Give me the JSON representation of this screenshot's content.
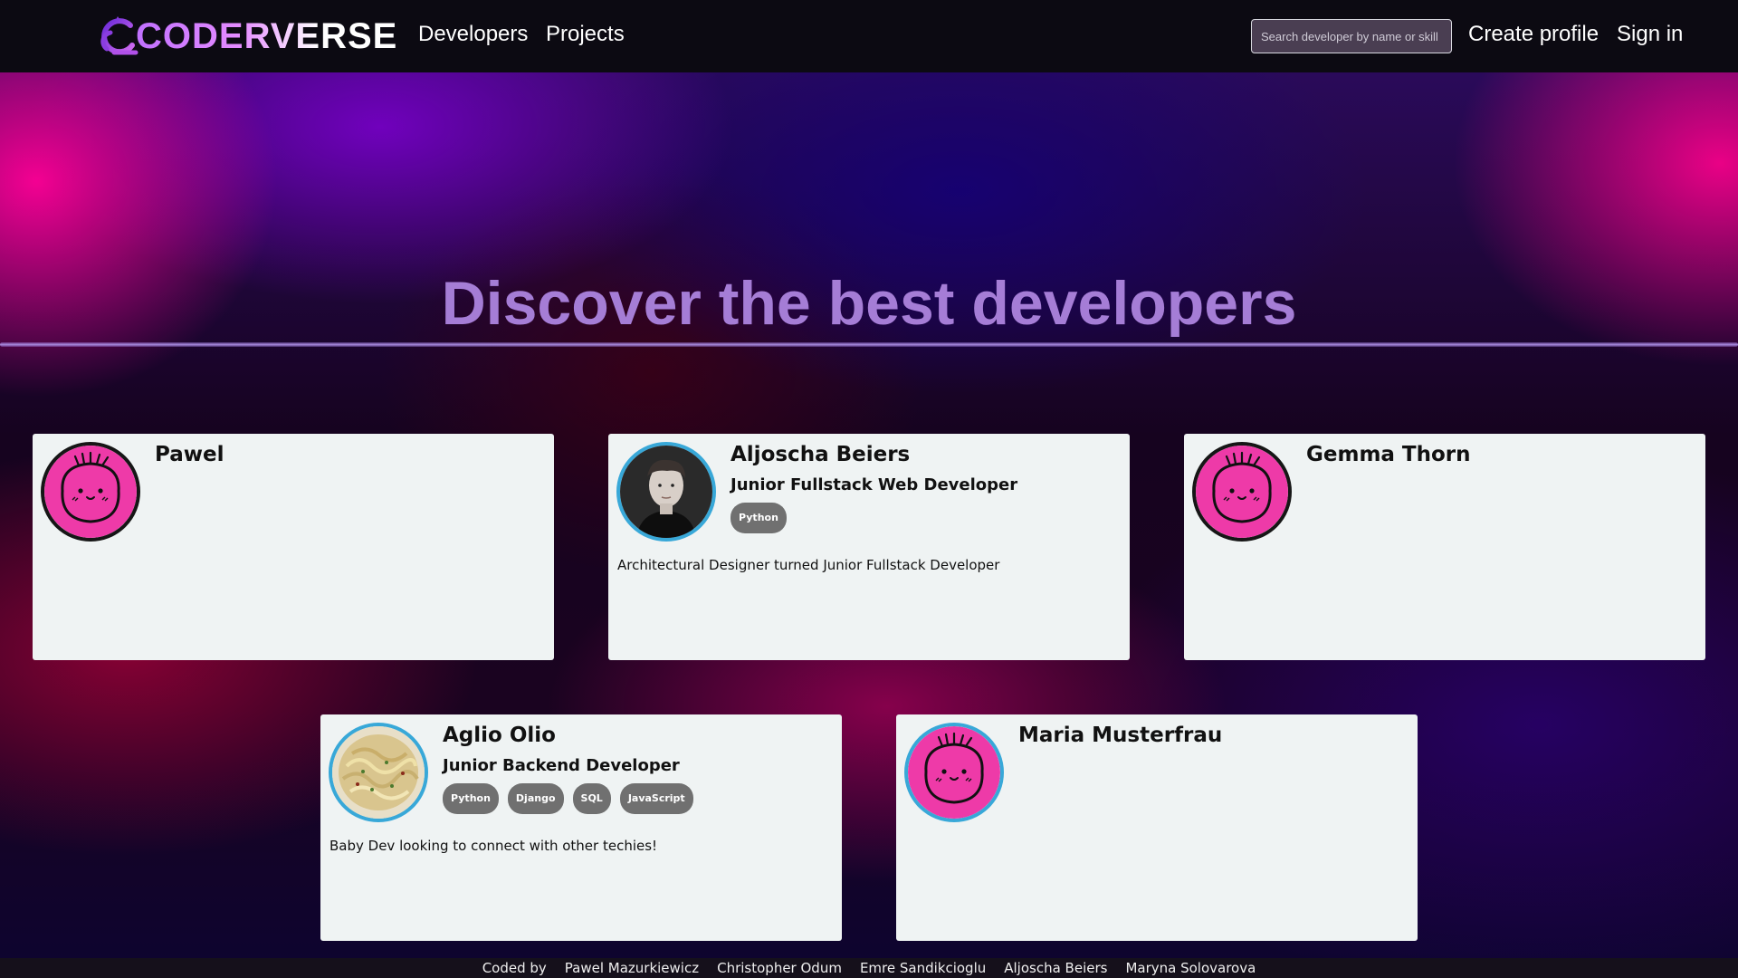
{
  "navbar": {
    "brand": "CODERVERSE",
    "links": {
      "developers": "Developers",
      "projects": "Projects",
      "create_profile": "Create profile",
      "sign_in": "Sign in"
    },
    "search_placeholder": "Search developer by name or skill"
  },
  "hero": {
    "title": "Discover the best developers"
  },
  "cards": [
    {
      "name": "Pawel",
      "role": "",
      "tags": [],
      "bio": "",
      "avatar": "pink-face-avatar"
    },
    {
      "name": "Aljoscha Beiers",
      "role": "Junior Fullstack Web Developer",
      "tags": [
        "Python"
      ],
      "bio": "Architectural Designer turned Junior Fullstack Developer",
      "avatar": "person-photo"
    },
    {
      "name": "Gemma Thorn",
      "role": "",
      "tags": [],
      "bio": "",
      "avatar": "pink-face-avatar"
    },
    {
      "name": "Aglio Olio",
      "role": "Junior Backend Developer",
      "tags": [
        "Python",
        "Django",
        "SQL",
        "JavaScript"
      ],
      "bio": "Baby Dev looking to connect with other techies!",
      "avatar": "pasta-photo"
    },
    {
      "name": "Maria Musterfrau",
      "role": "",
      "tags": [],
      "bio": "",
      "avatar": "pink-face-avatar"
    }
  ],
  "footer": {
    "label": "Coded by",
    "authors": [
      "Pawel Mazurkiewicz",
      "Christopher Odum",
      "Emre Sandikcioglu",
      "Aljoscha Beiers",
      "Maryna Solovarova"
    ]
  },
  "colors": {
    "accent": "#a57dd6",
    "avatar_pink": "#ee3aa8",
    "avatar_ring_blue": "#38a8d8"
  }
}
